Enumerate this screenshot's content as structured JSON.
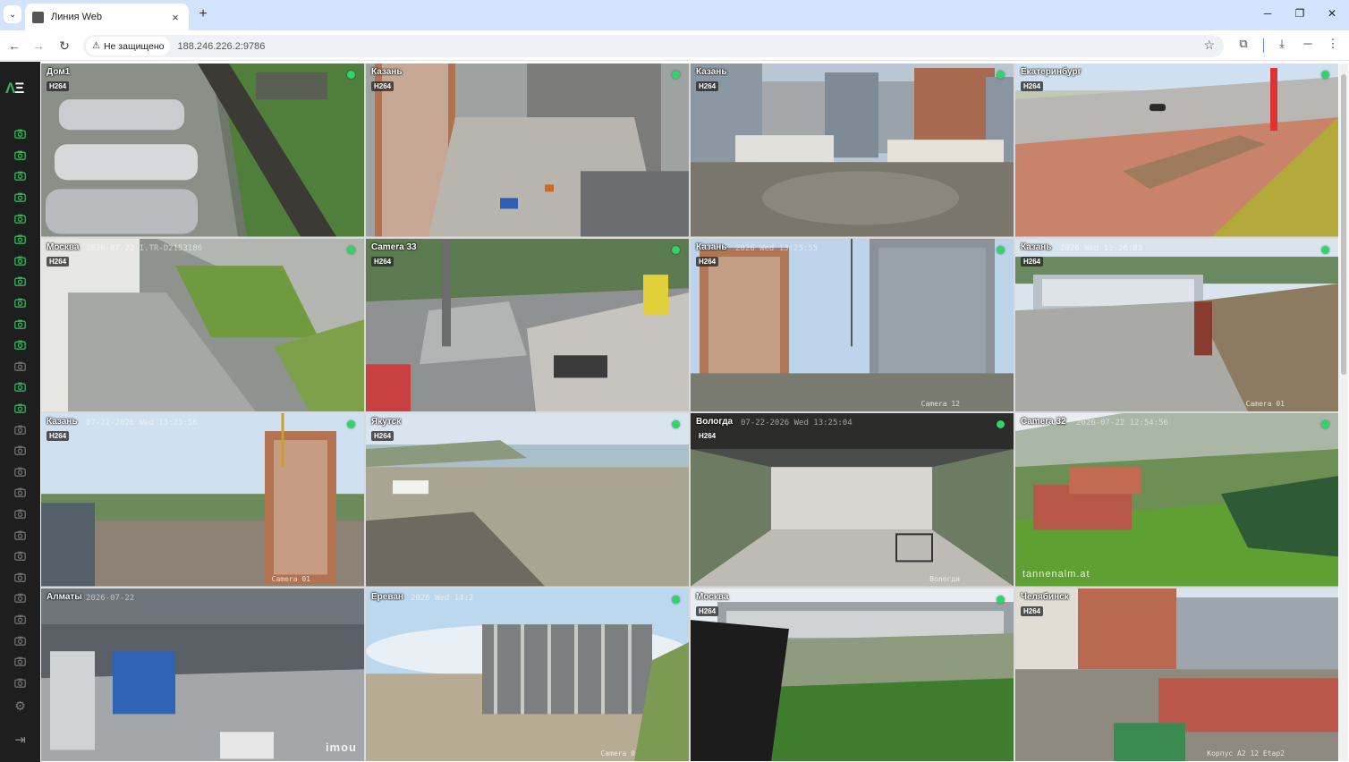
{
  "browser": {
    "tab_title": "Линия Web",
    "new_tab_symbol": "+",
    "security_label": "Не защищено",
    "url": "188.246.226.2:9786"
  },
  "app": {
    "logo_text": "ΛΞ",
    "sidebar_cameras": [
      {
        "active": true
      },
      {
        "active": true
      },
      {
        "active": true
      },
      {
        "active": true
      },
      {
        "active": true
      },
      {
        "active": true
      },
      {
        "active": true
      },
      {
        "active": true
      },
      {
        "active": true
      },
      {
        "active": true
      },
      {
        "active": true
      },
      {
        "active": false
      },
      {
        "active": true
      },
      {
        "active": true
      },
      {
        "active": false
      },
      {
        "active": false
      },
      {
        "active": false
      },
      {
        "active": false
      },
      {
        "active": false
      },
      {
        "active": false
      },
      {
        "active": false
      },
      {
        "active": false
      },
      {
        "active": false
      },
      {
        "active": false
      },
      {
        "active": false
      },
      {
        "active": false
      },
      {
        "active": false
      }
    ],
    "colors": {
      "sidebar_bg": "#1e1e1e",
      "camera_active": "#2fb45a",
      "camera_inactive": "#6f6f6f",
      "status_online": "#31d46a"
    },
    "tiles": [
      {
        "name": "Дом1",
        "codec": "H264",
        "online": true,
        "scene": "parking",
        "osd": ""
      },
      {
        "name": "Казань",
        "codec": "H264",
        "online": true,
        "scene": "construction-top",
        "osd": ""
      },
      {
        "name": "Казань",
        "codec": "H264",
        "online": true,
        "scene": "buildings-mud",
        "osd": ""
      },
      {
        "name": "Екатеринбург",
        "codec": "H264",
        "online": true,
        "scene": "roadside",
        "osd": ""
      },
      {
        "name": "Москва",
        "codec": "H264",
        "online": true,
        "scene": "courtyard",
        "osd": "2026-07-22 1.TR-D2153186"
      },
      {
        "name": "Camera 33",
        "codec": "H264",
        "online": true,
        "scene": "street",
        "osd": ""
      },
      {
        "name": "Казань",
        "codec": "H264",
        "online": true,
        "scene": "towers",
        "osd": "2026 Wed 13:25:55",
        "osd_bottom": "Camera 12"
      },
      {
        "name": "Казань",
        "codec": "H264",
        "online": true,
        "scene": "cabins",
        "osd": "2026 Wed 13:26:03",
        "osd_bottom": "Camera 01"
      },
      {
        "name": "Казань",
        "codec": "H264",
        "online": true,
        "scene": "city-panorama",
        "osd": "07-22-2026 Wed 13:25:56",
        "osd_bottom": "Camera 01"
      },
      {
        "name": "Якутск",
        "codec": "H264",
        "online": true,
        "scene": "riverbank",
        "osd": ""
      },
      {
        "name": "Вологда",
        "codec": "H264",
        "online": true,
        "scene": "hall",
        "osd": "07-22-2026 Wed 13:25:04",
        "osd_bottom": "Вологда"
      },
      {
        "name": "Camera 32",
        "codec": "",
        "online": true,
        "scene": "alps",
        "osd": "2026-07-22 12:54:56",
        "watermark2": "tannenalm.at"
      },
      {
        "name": "Алматы",
        "codec": "",
        "online": false,
        "scene": "workshop",
        "osd": "2026-07-22",
        "watermark": "imou"
      },
      {
        "name": "Ереван",
        "codec": "",
        "online": true,
        "scene": "frame-building",
        "osd": "2026 Wed 14:2",
        "osd_bottom": "Camera 0"
      },
      {
        "name": "Москва",
        "codec": "H264",
        "online": true,
        "scene": "cottages",
        "osd": ""
      },
      {
        "name": "Челябинск",
        "codec": "H264",
        "online": false,
        "scene": "site-red",
        "osd": "",
        "osd_bottom": "Корпус A2 12 Etap2"
      }
    ]
  }
}
